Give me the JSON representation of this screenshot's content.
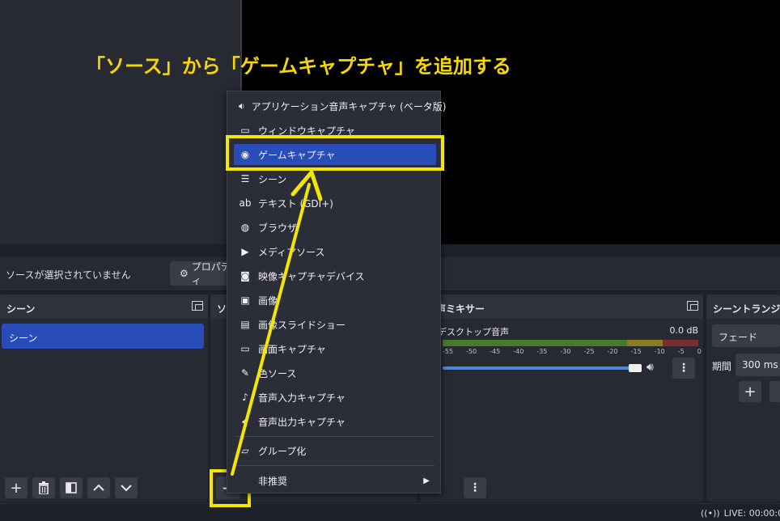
{
  "annotation": "「ソース」から「ゲームキャプチャ」を追加する",
  "context_bar": {
    "message": "ソースが選択されていません",
    "properties_label": "プロパティ"
  },
  "scenes_dock": {
    "title": "シーン",
    "items": [
      "シーン"
    ]
  },
  "sources_dock": {
    "title": "ソース",
    "add_button": "+"
  },
  "mixer_dock": {
    "title": "音声ミキサー",
    "device": "デスクトップ音声",
    "level": "0.0 dB",
    "ticks": [
      "-55",
      "-50",
      "-45",
      "-40",
      "-35",
      "-30",
      "-25",
      "-20",
      "-15",
      "-10",
      "-5",
      "0"
    ],
    "volume_fraction": 1.0
  },
  "transitions_dock": {
    "title": "シーントランジション",
    "transition": "フェード",
    "duration_label": "期間",
    "duration_value": "300 ms"
  },
  "status_bar": {
    "live": "LIVE: 00:00:00"
  },
  "menu": {
    "items": [
      {
        "label": "アプリケーション音声キャプチャ (ベータ版)",
        "icon": "app-audio-icon"
      },
      {
        "label": "ウィンドウキャプチャ",
        "icon": "window-icon"
      },
      {
        "label": "ゲームキャプチャ",
        "icon": "gamepad-icon",
        "active": true
      },
      {
        "label": "シーン",
        "icon": "list-icon"
      },
      {
        "label": "テキスト (GDI+)",
        "icon": "text-icon"
      },
      {
        "label": "ブラウザ",
        "icon": "globe-icon"
      },
      {
        "label": "メディアソース",
        "icon": "play-icon"
      },
      {
        "label": "映像キャプチャデバイス",
        "icon": "camera-icon"
      },
      {
        "label": "画像",
        "icon": "image-icon"
      },
      {
        "label": "画像スライドショー",
        "icon": "slideshow-icon"
      },
      {
        "label": "画面キャプチャ",
        "icon": "monitor-icon"
      },
      {
        "label": "色ソース",
        "icon": "brush-icon"
      },
      {
        "label": "音声入力キャプチャ",
        "icon": "microphone-icon"
      },
      {
        "label": "音声出力キャプチャ",
        "icon": "speaker-icon"
      }
    ],
    "group_label": "グループ化",
    "deprecated_label": "非推奨"
  },
  "colors": {
    "accent": "#284cb8",
    "highlight": "#f5e600",
    "annotation": "#f5d800"
  }
}
